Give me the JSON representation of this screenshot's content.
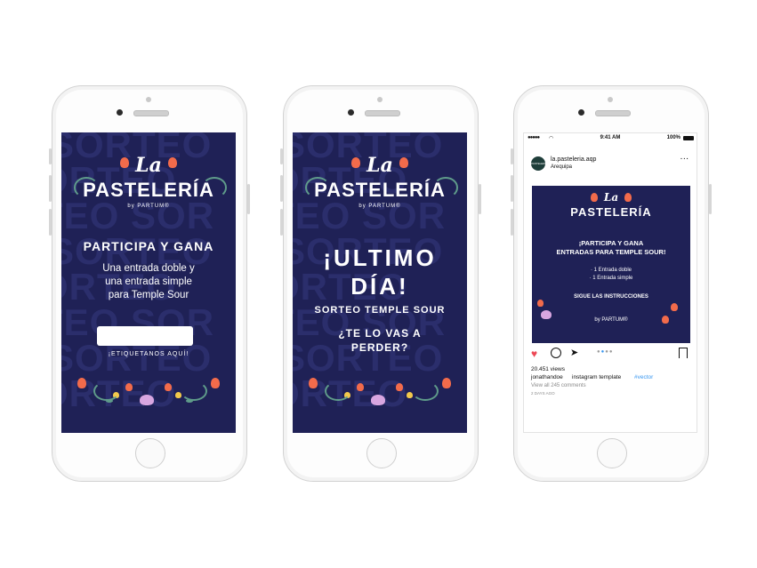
{
  "phone1": {
    "watermark": [
      "SORTEO",
      "SORTEO",
      "TEO SOR",
      "SORTEO",
      "SORTEO",
      "TEO SOR",
      "SORTEO",
      "SORTEO"
    ],
    "logo_la": "La",
    "logo_main": "PASTELERÍA",
    "logo_by": "by PARTUM®",
    "heading": "PARTICIPA Y GANA",
    "body_line1": "Una entrada doble y",
    "body_line2": "una entrada simple",
    "body_line3": "para Temple Sour",
    "input_value": "",
    "tag_label": "¡ETIQUETANOS AQUÍ!"
  },
  "phone2": {
    "logo_la": "La",
    "logo_main": "PASTELERÍA",
    "logo_by": "by PARTUM®",
    "big_line1": "¡ULTIMO",
    "big_line2": "DÍA!",
    "subtitle": "SORTEO TEMPLE SOUR",
    "question_line1": "¿TE LO VAS A",
    "question_line2": "PERDER?"
  },
  "phone3": {
    "status_time": "9:41 AM",
    "status_battery": "100%",
    "account_name": "la.pasteleria.aqp",
    "location": "Arequipa",
    "avatar_text": "PASTELERÍA",
    "post": {
      "logo_la": "La",
      "logo_main": "PASTELERÍA",
      "headline_line1": "¡PARTICIPA Y GANA",
      "headline_line2": "ENTRADAS PARA TEMPLE SOUR!",
      "item1": "· 1 Entrada doble",
      "item2": "· 1 Entrada simple",
      "instructions": "SIGUE LAS INSTRUCCIONES",
      "by": "by PARTUM®"
    },
    "views": "20.451 views",
    "username": "jonathandoe",
    "caption": "instagram template",
    "hashtag": "#vector",
    "comments": "View all 245 comments",
    "time_ago": "2 DAYS AGO"
  },
  "colors": {
    "navy": "#1f2156",
    "coral": "#f26b4b",
    "teal": "#5f9b8a",
    "heart": "#ed4956",
    "link": "#3897f0"
  }
}
